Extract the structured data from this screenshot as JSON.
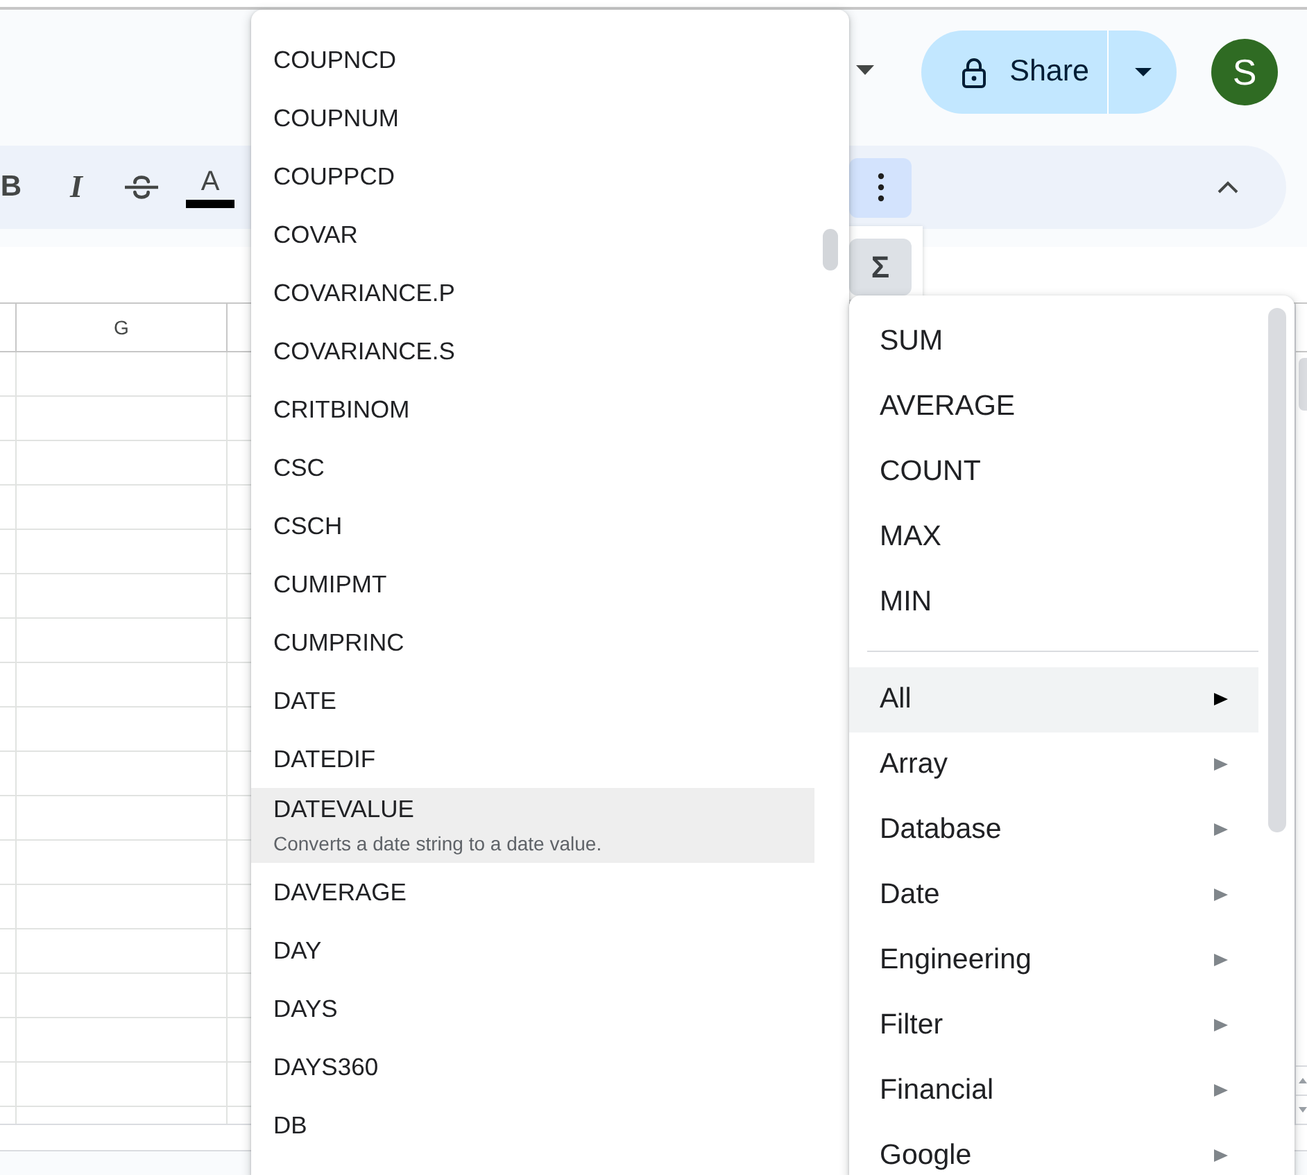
{
  "header": {
    "share_button": {
      "label": "Share"
    },
    "avatar": {
      "initial": "S"
    }
  },
  "toolbar": {
    "buttons": [
      {
        "kind": "bold",
        "label": "B"
      },
      {
        "kind": "italic",
        "label": "I"
      },
      {
        "kind": "strikethrough"
      },
      {
        "kind": "text_color",
        "label": "A"
      }
    ],
    "more_button": {
      "expanded": true
    }
  },
  "overflow_panel": {
    "functions_button": {
      "label": "Σ",
      "expanded": true
    }
  },
  "grid": {
    "column_header": "G"
  },
  "function_list": {
    "items": [
      {
        "name": "COUPNCD",
        "selected": false
      },
      {
        "name": "COUPNUM",
        "selected": false
      },
      {
        "name": "COUPPCD",
        "selected": false
      },
      {
        "name": "COVAR",
        "selected": false
      },
      {
        "name": "COVARIANCE.P",
        "selected": false
      },
      {
        "name": "COVARIANCE.S",
        "selected": false
      },
      {
        "name": "CRITBINOM",
        "selected": false
      },
      {
        "name": "CSC",
        "selected": false
      },
      {
        "name": "CSCH",
        "selected": false
      },
      {
        "name": "CUMIPMT",
        "selected": false
      },
      {
        "name": "CUMPRINC",
        "selected": false
      },
      {
        "name": "DATE",
        "selected": false
      },
      {
        "name": "DATEDIF",
        "selected": false
      },
      {
        "name": "DATEVALUE",
        "description": "Converts a date string to a date value.",
        "selected": true
      },
      {
        "name": "DAVERAGE",
        "selected": false
      },
      {
        "name": "DAY",
        "selected": false
      },
      {
        "name": "DAYS",
        "selected": false
      },
      {
        "name": "DAYS360",
        "selected": false
      },
      {
        "name": "DB",
        "selected": false
      }
    ]
  },
  "category_menu": {
    "quick_functions": [
      {
        "label": "SUM",
        "selected": false
      },
      {
        "label": "AVERAGE",
        "selected": false
      },
      {
        "label": "COUNT",
        "selected": false
      },
      {
        "label": "MAX",
        "selected": false
      },
      {
        "label": "MIN",
        "selected": false
      }
    ],
    "categories": [
      {
        "label": "All",
        "selected": true
      },
      {
        "label": "Array",
        "selected": false
      },
      {
        "label": "Database",
        "selected": false
      },
      {
        "label": "Date",
        "selected": false
      },
      {
        "label": "Engineering",
        "selected": false
      },
      {
        "label": "Filter",
        "selected": false
      },
      {
        "label": "Financial",
        "selected": false
      },
      {
        "label": "Google",
        "selected": false
      }
    ]
  }
}
